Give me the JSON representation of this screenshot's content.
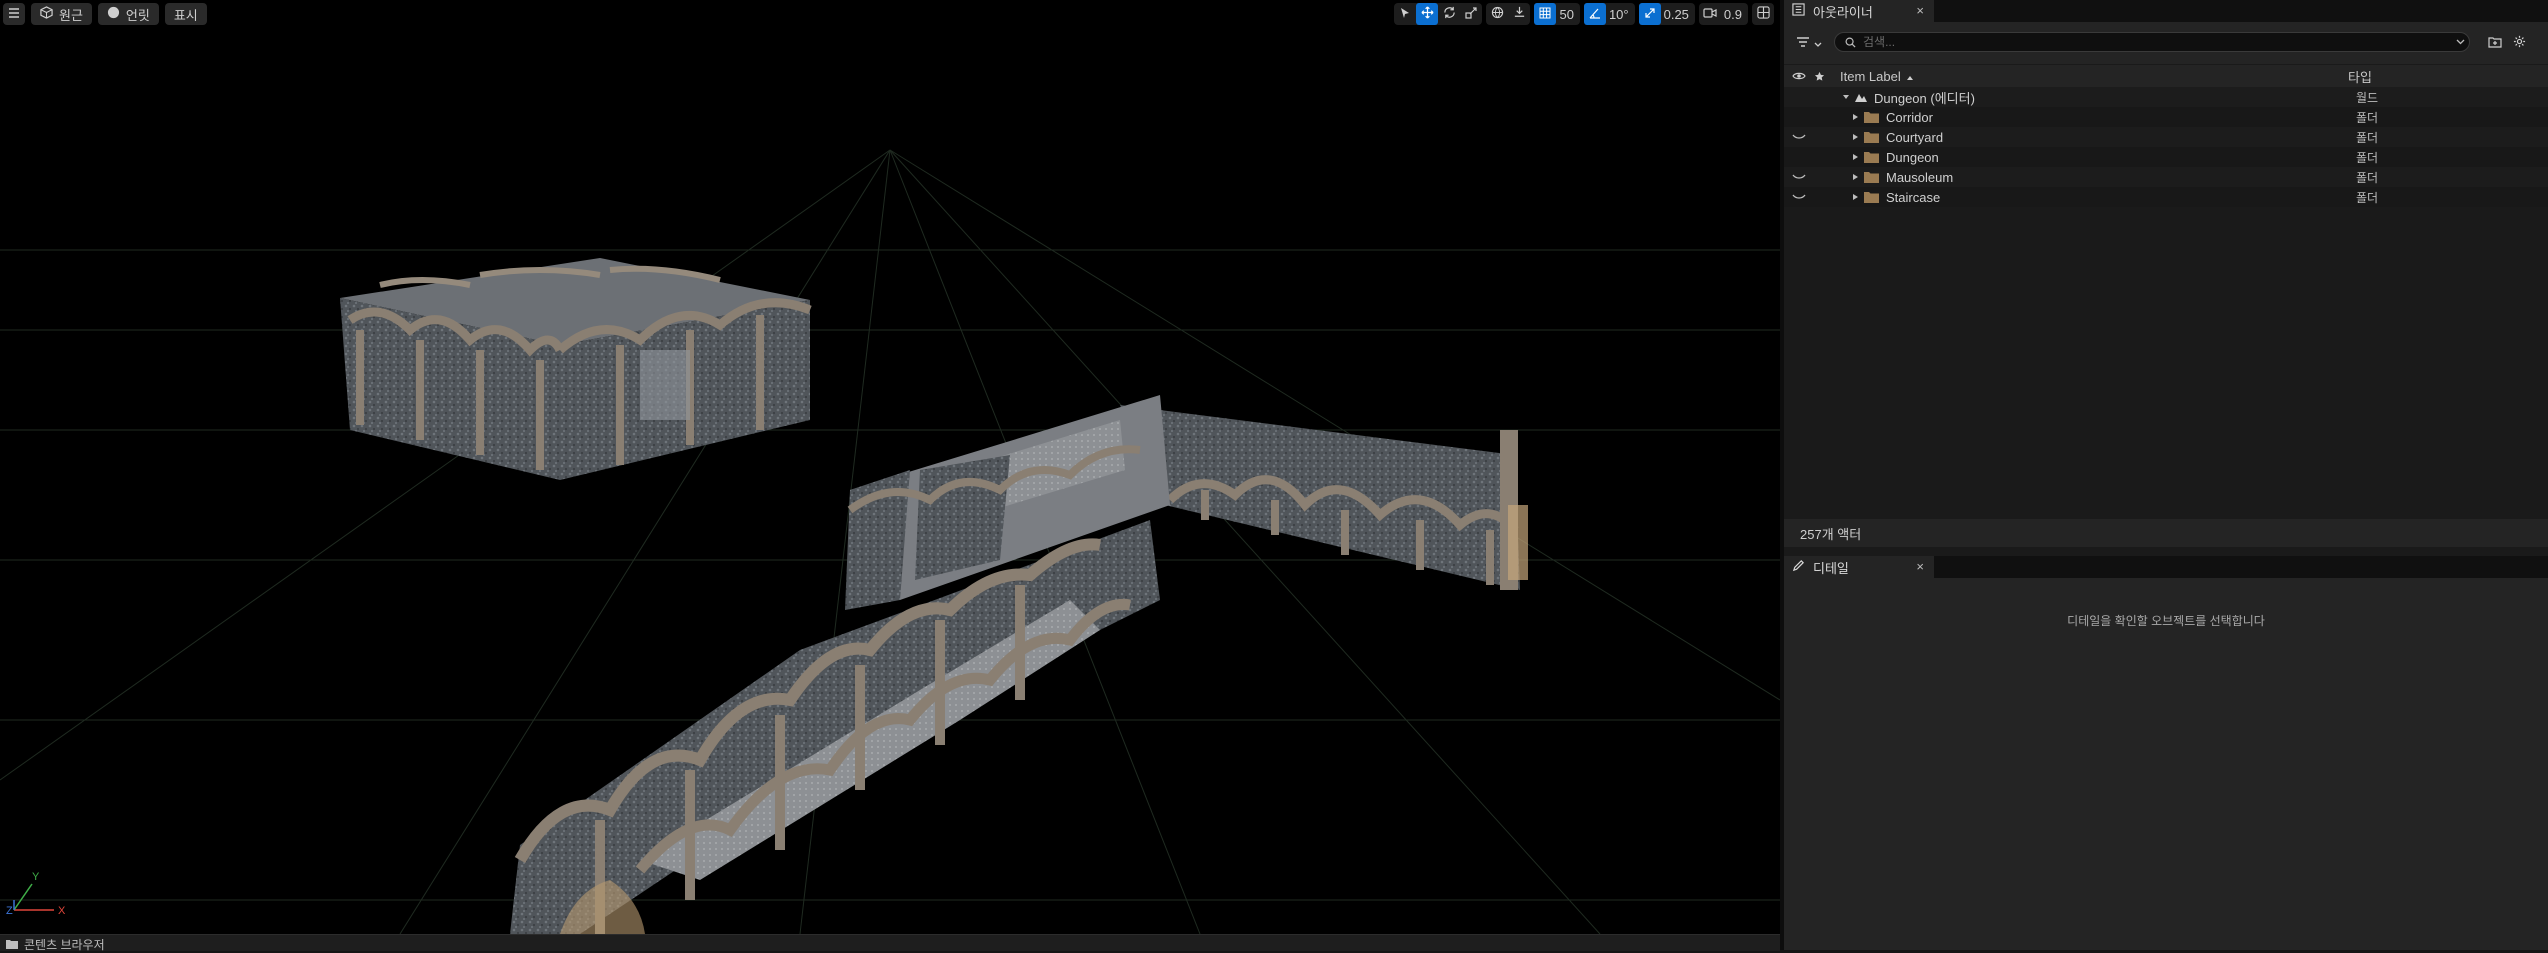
{
  "viewport": {
    "view_mode": "원근",
    "lit_mode": "언릿",
    "show_label": "표시",
    "grid_snap": "50",
    "rotation_snap": "10°",
    "scale_snap": "0.25",
    "camera_speed": "0.9"
  },
  "bottom": {
    "tab_label": "콘텐츠 브라우저"
  },
  "outliner": {
    "tab_title": "아웃라이너",
    "close": "×",
    "search_placeholder": "검색...",
    "col_label": "Item Label",
    "col_type": "타입",
    "root": {
      "label": "Dungeon (에디터)",
      "type": "월드"
    },
    "items": [
      {
        "label": "Corridor",
        "type": "폴더",
        "hidden": false
      },
      {
        "label": "Courtyard",
        "type": "폴더",
        "hidden": true
      },
      {
        "label": "Dungeon",
        "type": "폴더",
        "hidden": false
      },
      {
        "label": "Mausoleum",
        "type": "폴더",
        "hidden": true
      },
      {
        "label": "Staircase",
        "type": "폴더",
        "hidden": true
      }
    ],
    "actor_count": "257개 액터"
  },
  "details": {
    "tab_title": "디테일",
    "close": "×",
    "empty_message": "디테일을 확인할 오브젝트를 선택합니다"
  },
  "colors": {
    "accent": "#0b6fd1",
    "folder": "#9a7b52",
    "stone": "#5f6469",
    "arch": "#8a7f72"
  }
}
